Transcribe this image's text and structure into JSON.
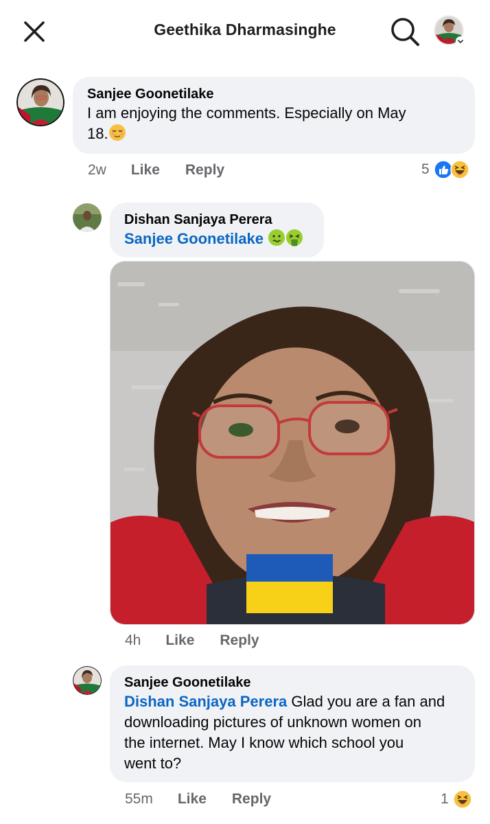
{
  "header": {
    "title": "Geethika Dharmasinghe"
  },
  "comments": [
    {
      "author": "Sanjee Goonetilake",
      "text_line1": "I am enjoying the comments. Especially on May",
      "text_line2": "18.",
      "time": "2w",
      "like": "Like",
      "reply": "Reply",
      "reaction_count": "5"
    },
    {
      "author": "Dishan Sanjaya Perera",
      "mention": "Sanjee Goonetilake",
      "time": "4h",
      "like": "Like",
      "reply": "Reply"
    },
    {
      "author": "Sanjee Goonetilake",
      "mention": "Dishan Sanjaya Perera",
      "text_line1_rest": " Glad you are a fan and",
      "text_line2": "downloading pictures of unknown women on",
      "text_line3": "the internet. May I know which school you",
      "text_line4": "went to?",
      "time": "55m",
      "like": "Like",
      "reply": "Reply",
      "reaction_count": "1"
    }
  ],
  "icons": [
    "close-icon",
    "search-icon",
    "profile-avatar",
    "like-reaction-icon",
    "haha-reaction-icon",
    "relieved-emoji",
    "nauseated-emoji",
    "vomiting-emoji",
    "ukraine-flag"
  ],
  "colors": {
    "bubble": "#f0f2f5",
    "mention": "#0a66c2",
    "meta": "#65676b",
    "like_blue": "#1877f2",
    "haha_yellow": "#f7c03f"
  }
}
